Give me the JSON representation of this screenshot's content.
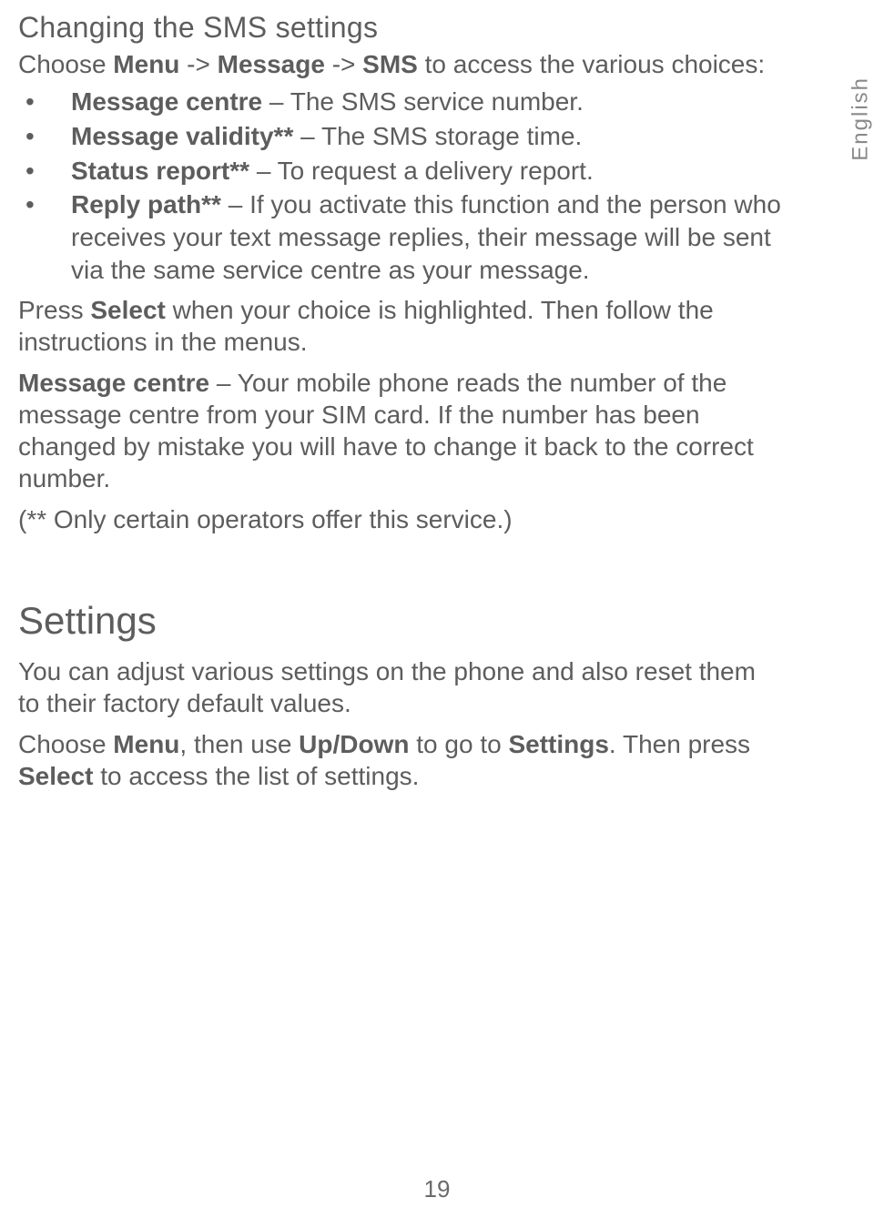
{
  "sideLabel": "English",
  "pageNumber": "19",
  "sms": {
    "title": "Changing the SMS settings",
    "intro_pre": "Choose ",
    "intro_menu": "Menu",
    "intro_arrow1": " -> ",
    "intro_message": "Message",
    "intro_arrow2": " -> ",
    "intro_sms": "SMS",
    "intro_post": " to access the various choices:",
    "bullets": [
      {
        "bold": "Message centre",
        "rest": " – The SMS service number."
      },
      {
        "bold": "Message validity**",
        "rest": " – The SMS storage time."
      },
      {
        "bold": "Status report**",
        "rest": " – To request a delivery report."
      },
      {
        "bold": "Reply path**",
        "rest": " – If you activate this function and the person who receives your text message replies, their message will be sent via the same service centre as your message."
      }
    ],
    "press_pre": "Press ",
    "press_bold": "Select",
    "press_post": " when your choice is highlighted. Then follow the instructions in the menus.",
    "mc_bold": "Message centre",
    "mc_rest": " – Your mobile phone reads the number of the message centre from your SIM card. If the number has been changed by mistake you will have to change it back to the correct number.",
    "footnote": "(** Only certain operators offer this service.)"
  },
  "settings": {
    "title": "Settings",
    "intro": "You can adjust various settings on the phone and also reset them to their factory default values.",
    "nav_pre": "Choose ",
    "nav_menu": "Menu",
    "nav_mid1": ", then use ",
    "nav_updown": "Up/Down",
    "nav_mid2": " to go to ",
    "nav_settings": "Settings",
    "nav_mid3": ". Then press ",
    "nav_select": "Select",
    "nav_post": " to access the list of settings."
  }
}
